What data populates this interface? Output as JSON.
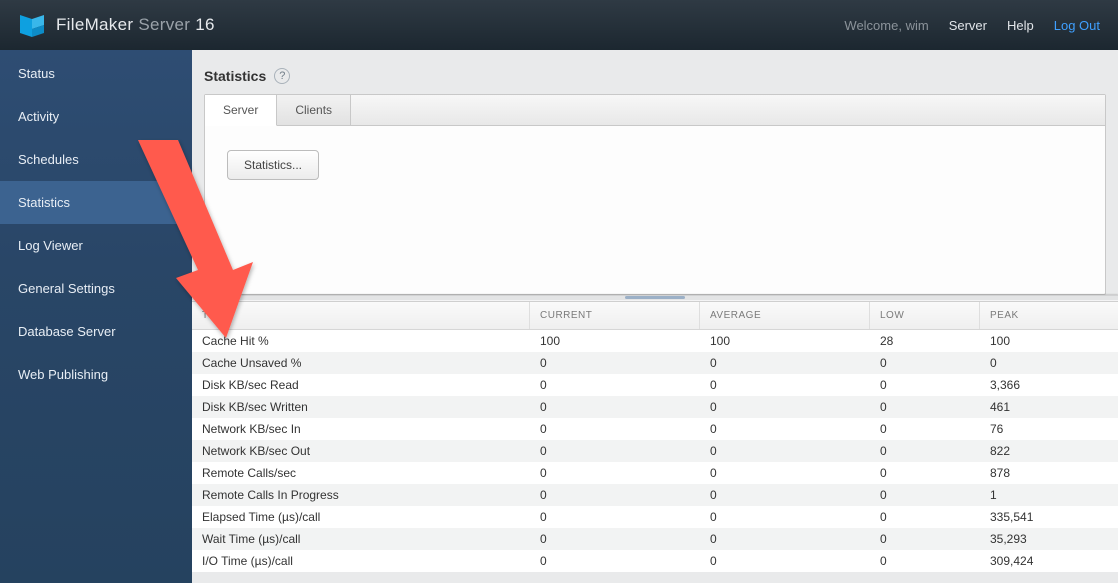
{
  "topbar": {
    "brand1": "FileMaker",
    "brand2": "Server",
    "brand3": "16",
    "welcome": "Welcome, wim",
    "links": {
      "server": "Server",
      "help": "Help",
      "logout": "Log Out"
    }
  },
  "sidebar": {
    "items": [
      {
        "label": "Status"
      },
      {
        "label": "Activity"
      },
      {
        "label": "Schedules"
      },
      {
        "label": "Statistics",
        "active": true
      },
      {
        "label": "Log Viewer"
      },
      {
        "label": "General Settings"
      },
      {
        "label": "Database Server"
      },
      {
        "label": "Web Publishing"
      }
    ]
  },
  "page": {
    "title": "Statistics",
    "help_glyph": "?",
    "tabs": [
      {
        "label": "Server",
        "active": true
      },
      {
        "label": "Clients"
      }
    ],
    "settings_button": "Statistics..."
  },
  "table": {
    "headers": [
      "TYPE",
      "CURRENT",
      "AVERAGE",
      "LOW",
      "PEAK"
    ],
    "rows": [
      {
        "type": "Cache Hit %",
        "current": "100",
        "average": "100",
        "low": "28",
        "peak": "100"
      },
      {
        "type": "Cache Unsaved %",
        "current": "0",
        "average": "0",
        "low": "0",
        "peak": "0"
      },
      {
        "type": "Disk KB/sec Read",
        "current": "0",
        "average": "0",
        "low": "0",
        "peak": "3,366"
      },
      {
        "type": "Disk KB/sec Written",
        "current": "0",
        "average": "0",
        "low": "0",
        "peak": "461"
      },
      {
        "type": "Network KB/sec In",
        "current": "0",
        "average": "0",
        "low": "0",
        "peak": "76"
      },
      {
        "type": "Network KB/sec Out",
        "current": "0",
        "average": "0",
        "low": "0",
        "peak": "822"
      },
      {
        "type": "Remote Calls/sec",
        "current": "0",
        "average": "0",
        "low": "0",
        "peak": "878"
      },
      {
        "type": "Remote Calls In Progress",
        "current": "0",
        "average": "0",
        "low": "0",
        "peak": "1"
      },
      {
        "type": "Elapsed Time (µs)/call",
        "current": "0",
        "average": "0",
        "low": "0",
        "peak": "335,541"
      },
      {
        "type": "Wait Time (µs)/call",
        "current": "0",
        "average": "0",
        "low": "0",
        "peak": "35,293"
      },
      {
        "type": "I/O Time (µs)/call",
        "current": "0",
        "average": "0",
        "low": "0",
        "peak": "309,424"
      }
    ]
  }
}
